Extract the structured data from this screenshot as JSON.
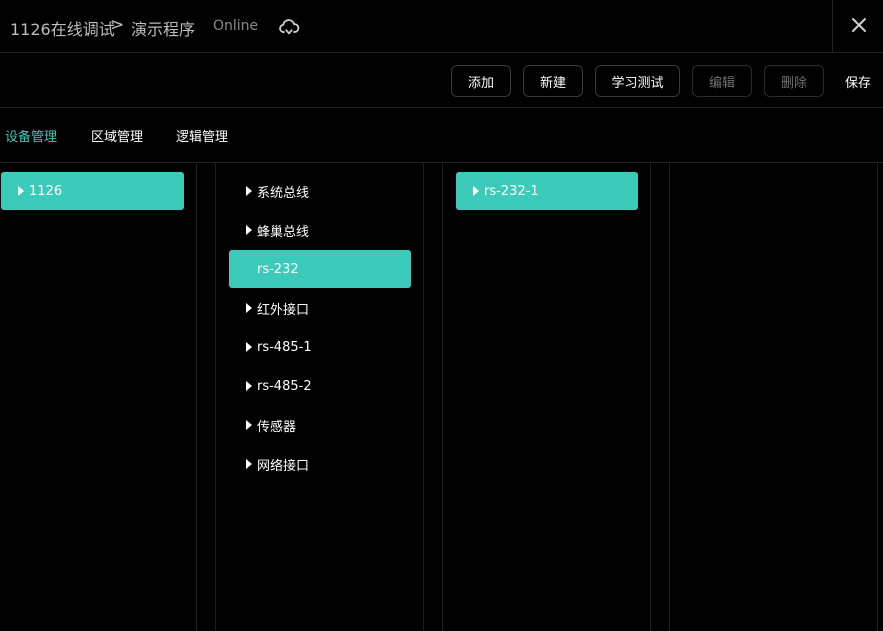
{
  "header": {
    "root": "1126在线调试",
    "separator": ">",
    "page": "演示程序",
    "status": "Online"
  },
  "toolbar": {
    "add": "添加",
    "new": "新建",
    "learn_test": "学习测试",
    "edit": "编辑",
    "delete": "删除",
    "save": "保存"
  },
  "tabs": [
    "设备管理",
    "区域管理",
    "逻辑管理"
  ],
  "columns": {
    "devices": [
      "1126"
    ],
    "interfaces": [
      "系统总线",
      "蜂巢总线",
      "rs-232",
      "红外接口",
      "rs-485-1",
      "rs-485-2",
      "传感器",
      "网络接口"
    ],
    "ports": [
      "rs-232-1"
    ]
  },
  "colors": {
    "accent": "#3ccbbb",
    "background": "#000000"
  }
}
